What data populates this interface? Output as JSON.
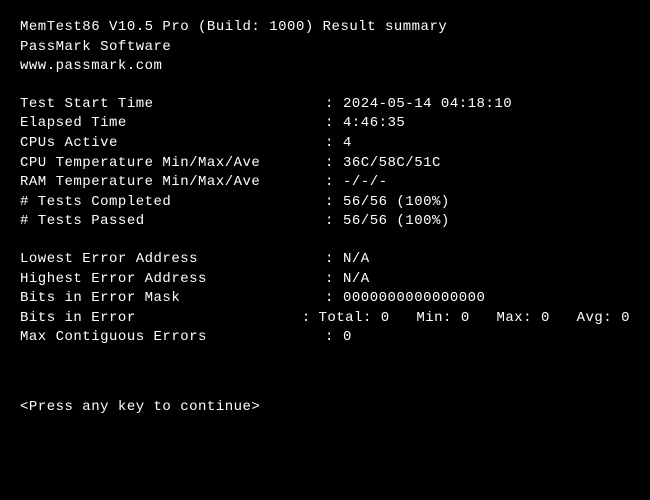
{
  "header": {
    "title": "MemTest86 V10.5 Pro (Build: 1000) Result summary",
    "company": "PassMark Software",
    "url": "www.passmark.com"
  },
  "summary": {
    "start_time_label": "Test Start Time",
    "start_time_value": "2024-05-14 04:18:10",
    "elapsed_label": "Elapsed Time",
    "elapsed_value": "4:46:35",
    "cpus_active_label": "CPUs Active",
    "cpus_active_value": "4",
    "cpu_temp_label": "CPU Temperature Min/Max/Ave",
    "cpu_temp_value": "36C/58C/51C",
    "ram_temp_label": "RAM Temperature Min/Max/Ave",
    "ram_temp_value": "-/-/-",
    "tests_completed_label": "# Tests Completed",
    "tests_completed_value": "56/56 (100%)",
    "tests_passed_label": "# Tests Passed",
    "tests_passed_value": "56/56 (100%)"
  },
  "errors": {
    "lowest_addr_label": "Lowest Error Address",
    "lowest_addr_value": "N/A",
    "highest_addr_label": "Highest Error Address",
    "highest_addr_value": "N/A",
    "bits_mask_label": "Bits in Error Mask",
    "bits_mask_value": "0000000000000000",
    "bits_error_label": "Bits in Error",
    "bits_error_value": "Total: 0   Min: 0   Max: 0   Avg: 0",
    "max_contig_label": "Max Contiguous Errors",
    "max_contig_value": "0"
  },
  "prompt": "<Press any key to continue>"
}
